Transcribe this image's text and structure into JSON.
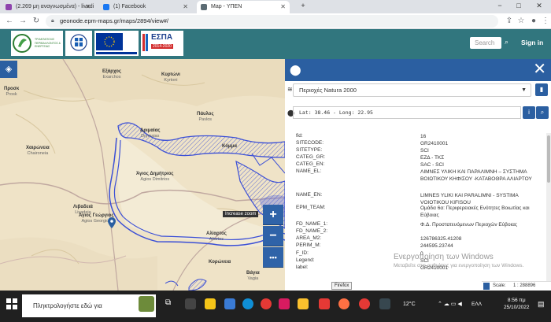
{
  "browser": {
    "tabs": [
      {
        "title": "(2.269 μη αναγνωσμένα) - livadi",
        "favicon_color": "#8e44ad"
      },
      {
        "title": "(1) Facebook",
        "favicon_color": "#1877f2"
      },
      {
        "title": "Map - ΥΠΕΝ",
        "favicon_color": "#5b6b73"
      }
    ],
    "url": "geonode.epm-maps.gr/maps/2894/view#/"
  },
  "header": {
    "search_placeholder": "Search",
    "signin_label": "Sign in",
    "logo_text": "ΤΡΙΑΝΤΑΠΟΛΙΣ ΠΕΡΙΒΑΛΛΟΝΤΟΣ & ΕΝΕΡΓΕΙΑΣ",
    "espa_label": "ΕΣΠΑ",
    "espa_years": "2014-2020"
  },
  "map": {
    "places": [
      {
        "el": "Εξάρχος",
        "en": "Exarchos"
      },
      {
        "el": "Κυρτώνι",
        "en": "Kyrtoni"
      },
      {
        "el": "Προσκ",
        "en": "Prosk"
      },
      {
        "el": "Πάυλος",
        "en": "Pavlos"
      },
      {
        "el": "Δριμαίας",
        "en": "Drymaias"
      },
      {
        "el": "Κόμμα",
        "en": ""
      },
      {
        "el": "Χαιρώνεια",
        "en": "Chaironeia"
      },
      {
        "el": "Λιβαδειά",
        "en": "Livadeia"
      },
      {
        "el": "Άγιος Δημήτριος",
        "en": "Agios Dimitrios"
      },
      {
        "el": "Άγιος Γεώργιος",
        "en": "Agios Georgios"
      },
      {
        "el": "Αλίαρτος",
        "en": "Aliartos"
      },
      {
        "el": "Κορώνεια",
        "en": ""
      },
      {
        "el": "Βάγια",
        "en": "Vagia"
      }
    ],
    "zoom_in_label": "+",
    "zoom_out_label": "−",
    "more_label": "•••",
    "zoom_tooltip": "Increase zoom"
  },
  "panel": {
    "layer_select": "Περιοχές Natura 2000",
    "coordinates": "Lat: 38.46 - Long: 22.95",
    "attributes": [
      {
        "key": "fid:",
        "value": "16"
      },
      {
        "key": "SITECODE:",
        "value": "GR2410001"
      },
      {
        "key": "SITETYPE:",
        "value": "SCI"
      },
      {
        "key": "CATEG_GR:",
        "value": "ΕΖΔ - ΤΚΣ"
      },
      {
        "key": "CATEG_EN:",
        "value": "SAC - SCI"
      },
      {
        "key": "NAME_EL:",
        "value": "ΛΙΜΝΕΣ ΥΛΙΚΗ ΚΑΙ ΠΑΡΑΛΙΜΝΗ – ΣΥΣΤΗΜΑ ΒΟΙΩΤΙΚΟΥ ΚΗΦΙΣΟΥ -ΚΑΤΑΒΟΘΡΑ ΑΛΙΑΡΤΟΥ"
      },
      {
        "key": "NAME_EN:",
        "value": "LIMNES YLIKI KAI PARALIMNI - SYSTIMA VOIOTIKOU KIFISOU"
      },
      {
        "key": "EPM_TEAM:",
        "value": "Ομάδα 6α: Περιφερειακές Ενότητες Βοιωτίας και Εύβοιας"
      },
      {
        "key": "FD_NAME_1:",
        "value": "Φ.Δ. Προστατευόμενων Περιοχών Εύβοιας"
      },
      {
        "key": "FD_NAME_2:",
        "value": ""
      },
      {
        "key": "AREA_M2:",
        "value": "126786325.41208"
      },
      {
        "key": "PERIM_M:",
        "value": "244595.23744"
      },
      {
        "key": "F_ID:",
        "value": "0"
      },
      {
        "key": "Legend:",
        "value": "SCI"
      },
      {
        "key": "label:",
        "value": "GR2410001"
      }
    ],
    "scale_label": "Scale:",
    "scale_value": "1 : 288896"
  },
  "watermark": {
    "title": "Ενεργοποίηση των Windows",
    "subtitle": "Μεταβείτε στις ρυθμίσεις για ενεργοποίηση των Windows."
  },
  "taskbar": {
    "search_placeholder": "Πληκτρολογήστε εδώ για",
    "firefox_tooltip": "Firefox",
    "temperature": "12°C",
    "language": "ΕΛΛ",
    "time": "8:56 πμ",
    "date": "25/10/2022"
  },
  "colors": {
    "site_header": "#31767e",
    "panel_blue": "#2b5fa1",
    "map_bg": "#efe3c7",
    "polygon": "#3b4fd6"
  }
}
